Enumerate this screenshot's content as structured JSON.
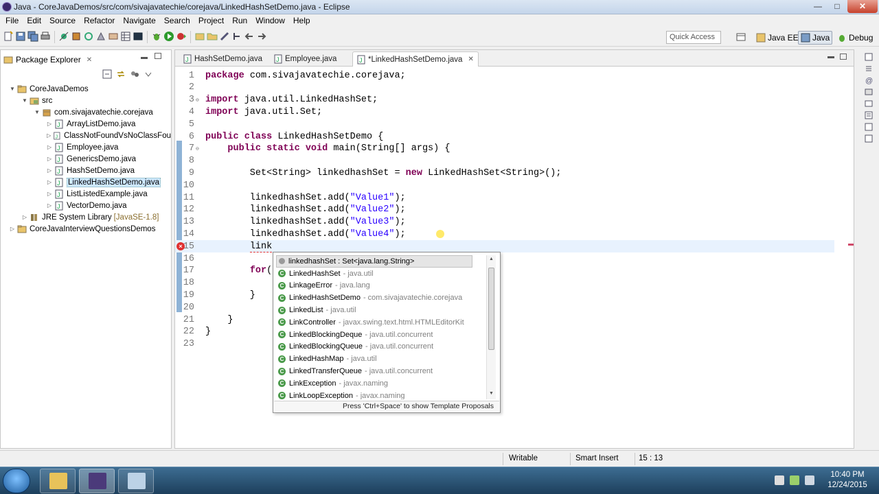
{
  "window": {
    "title": "Java - CoreJavaDemos/src/com/sivajavatechie/corejava/LinkedHashSetDemo.java - Eclipse",
    "min": "—",
    "max": "□",
    "close": "✕"
  },
  "menu": [
    "File",
    "Edit",
    "Source",
    "Refactor",
    "Navigate",
    "Search",
    "Project",
    "Run",
    "Window",
    "Help"
  ],
  "toolbar": {
    "quick_access": "Quick Access",
    "perspectives": [
      "Java EE",
      "Java",
      "Debug"
    ]
  },
  "package_explorer": {
    "title": "Package Explorer",
    "tree": [
      {
        "label": "CoreJavaDemos",
        "level": 0,
        "twisty": "▼",
        "icon": "project-icon"
      },
      {
        "label": "src",
        "level": 1,
        "twisty": "▼",
        "icon": "source-folder-icon"
      },
      {
        "label": "com.sivajavatechie.corejava",
        "level": 2,
        "twisty": "▼",
        "icon": "package-icon"
      },
      {
        "label": "ArrayListDemo.java",
        "level": 3,
        "twisty": "▷",
        "icon": "java-file-icon"
      },
      {
        "label": "ClassNotFoundVsNoClassFou",
        "level": 3,
        "twisty": "▷",
        "icon": "java-file-icon"
      },
      {
        "label": "Employee.java",
        "level": 3,
        "twisty": "▷",
        "icon": "java-file-icon"
      },
      {
        "label": "GenericsDemo.java",
        "level": 3,
        "twisty": "▷",
        "icon": "java-file-icon"
      },
      {
        "label": "HashSetDemo.java",
        "level": 3,
        "twisty": "▷",
        "icon": "java-file-icon"
      },
      {
        "label": "LinkedHashSetDemo.java",
        "level": 3,
        "twisty": "▷",
        "icon": "java-file-icon",
        "selected": true
      },
      {
        "label": "ListListedExample.java",
        "level": 3,
        "twisty": "▷",
        "icon": "java-file-icon"
      },
      {
        "label": "VectorDemo.java",
        "level": 3,
        "twisty": "▷",
        "icon": "java-file-icon"
      },
      {
        "label": "JRE System Library",
        "decoration": "[JavaSE-1.8]",
        "level": 1,
        "twisty": "▷",
        "icon": "library-icon"
      },
      {
        "label": "CoreJavaInterviewQuestionsDemos",
        "level": 0,
        "twisty": "▷",
        "icon": "project-icon"
      }
    ]
  },
  "editor": {
    "tabs": [
      {
        "label": "HashSetDemo.java",
        "active": false
      },
      {
        "label": "Employee.java",
        "active": false
      },
      {
        "label": "*LinkedHashSetDemo.java",
        "active": true
      }
    ],
    "lines": [
      {
        "n": "1",
        "fold": "",
        "tokens": [
          {
            "t": "package",
            "c": "kw"
          },
          {
            "t": " com.sivajavatechie.corejava;",
            "c": ""
          }
        ]
      },
      {
        "n": "2",
        "fold": "",
        "tokens": []
      },
      {
        "n": "3",
        "fold": "⊖",
        "tokens": [
          {
            "t": "import",
            "c": "kw"
          },
          {
            "t": " java.util.LinkedHashSet;",
            "c": ""
          }
        ]
      },
      {
        "n": "4",
        "fold": "",
        "tokens": [
          {
            "t": "import",
            "c": "kw"
          },
          {
            "t": " java.util.Set;",
            "c": ""
          }
        ]
      },
      {
        "n": "5",
        "fold": "",
        "tokens": []
      },
      {
        "n": "6",
        "fold": "",
        "tokens": [
          {
            "t": "public class",
            "c": "kw"
          },
          {
            "t": " LinkedHashSetDemo {",
            "c": ""
          }
        ]
      },
      {
        "n": "7",
        "fold": "⊖",
        "tokens": [
          {
            "t": "    ",
            "c": ""
          },
          {
            "t": "public static void",
            "c": "kw"
          },
          {
            "t": " main(String[] args) {",
            "c": ""
          }
        ]
      },
      {
        "n": "8",
        "fold": "",
        "tokens": []
      },
      {
        "n": "9",
        "fold": "",
        "tokens": [
          {
            "t": "        Set<String> linkedhashSet = ",
            "c": ""
          },
          {
            "t": "new",
            "c": "kw"
          },
          {
            "t": " LinkedHashSet<String>();",
            "c": ""
          }
        ]
      },
      {
        "n": "10",
        "fold": "",
        "tokens": []
      },
      {
        "n": "11",
        "fold": "",
        "tokens": [
          {
            "t": "        linkedhashSet.add(",
            "c": ""
          },
          {
            "t": "\"Value1\"",
            "c": "str"
          },
          {
            "t": ");",
            "c": ""
          }
        ]
      },
      {
        "n": "12",
        "fold": "",
        "tokens": [
          {
            "t": "        linkedhashSet.add(",
            "c": ""
          },
          {
            "t": "\"Value2\"",
            "c": "str"
          },
          {
            "t": ");",
            "c": ""
          }
        ]
      },
      {
        "n": "13",
        "fold": "",
        "tokens": [
          {
            "t": "        linkedhashSet.add(",
            "c": ""
          },
          {
            "t": "\"Value3\"",
            "c": "str"
          },
          {
            "t": ");",
            "c": ""
          }
        ]
      },
      {
        "n": "14",
        "fold": "",
        "tokens": [
          {
            "t": "        linkedhashSet.add(",
            "c": ""
          },
          {
            "t": "\"Value4\"",
            "c": "str"
          },
          {
            "t": ");",
            "c": ""
          }
        ]
      },
      {
        "n": "15",
        "fold": "",
        "current": true,
        "error": true,
        "tokens": [
          {
            "t": "        ",
            "c": ""
          },
          {
            "t": "link",
            "c": "sq"
          }
        ]
      },
      {
        "n": "16",
        "fold": "",
        "tokens": []
      },
      {
        "n": "17",
        "fold": "",
        "tokens": [
          {
            "t": "        ",
            "c": ""
          },
          {
            "t": "for",
            "c": "kw"
          },
          {
            "t": "(",
            "c": ""
          }
        ]
      },
      {
        "n": "18",
        "fold": "",
        "tokens": []
      },
      {
        "n": "19",
        "fold": "",
        "tokens": [
          {
            "t": "        }",
            "c": ""
          }
        ]
      },
      {
        "n": "20",
        "fold": "",
        "tokens": []
      },
      {
        "n": "21",
        "fold": "",
        "tokens": [
          {
            "t": "    }",
            "c": ""
          }
        ]
      },
      {
        "n": "22",
        "fold": "",
        "tokens": [
          {
            "t": "}",
            "c": ""
          }
        ]
      },
      {
        "n": "23",
        "fold": "",
        "tokens": []
      }
    ]
  },
  "content_assist": {
    "items": [
      {
        "name": "linkedhashSet : Set<java.lang.String>",
        "pkg": "",
        "kind": "field",
        "selected": true
      },
      {
        "name": "LinkedHashSet",
        "pkg": "- java.util",
        "kind": "class"
      },
      {
        "name": "LinkageError",
        "pkg": "- java.lang",
        "kind": "class"
      },
      {
        "name": "LinkedHashSetDemo",
        "pkg": "- com.sivajavatechie.corejava",
        "kind": "class"
      },
      {
        "name": "LinkedList",
        "pkg": "- java.util",
        "kind": "class"
      },
      {
        "name": "LinkController",
        "pkg": "- javax.swing.text.html.HTMLEditorKit",
        "kind": "class"
      },
      {
        "name": "LinkedBlockingDeque",
        "pkg": "- java.util.concurrent",
        "kind": "class"
      },
      {
        "name": "LinkedBlockingQueue",
        "pkg": "- java.util.concurrent",
        "kind": "class"
      },
      {
        "name": "LinkedHashMap",
        "pkg": "- java.util",
        "kind": "class"
      },
      {
        "name": "LinkedTransferQueue",
        "pkg": "- java.util.concurrent",
        "kind": "class"
      },
      {
        "name": "LinkException",
        "pkg": "- javax.naming",
        "kind": "class"
      },
      {
        "name": "LinkLoopException",
        "pkg": "- javax.naming",
        "kind": "class"
      }
    ],
    "footer": "Press 'Ctrl+Space' to show Template Proposals"
  },
  "status": {
    "writable": "Writable",
    "insert_mode": "Smart Insert",
    "position": "15 : 13"
  },
  "taskbar": {
    "time": "10:40 PM",
    "date": "12/24/2015"
  },
  "colors": {
    "keyword": "#7f0055",
    "string": "#2a00ff",
    "error": "#e03030",
    "current_line": "#e8f2fe"
  }
}
